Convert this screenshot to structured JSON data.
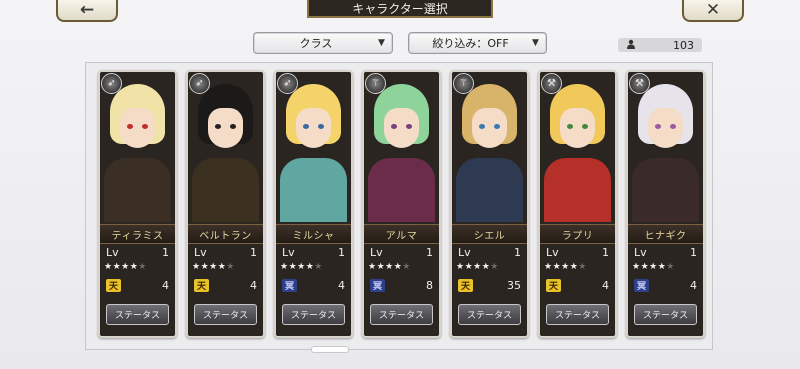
{
  "header": {
    "title": "キャラクター選択",
    "back_icon": "←",
    "close_icon": "✕"
  },
  "filters": {
    "class_label": "クラス",
    "filter_label": "絞り込み：OFF",
    "arrow": "▼"
  },
  "counter": {
    "value": "103",
    "icon": "person-icon"
  },
  "cards": [
    {
      "name": "ティラミス",
      "lv_label": "Lv",
      "lv": "1",
      "stars": "★★★★",
      "dim_star": "★",
      "badge": "天",
      "badge_color": "gold",
      "stat": "4",
      "button": "ステータス",
      "class_icon": "bow-icon",
      "hair": "#f1e3a8",
      "body": "#3b2f25",
      "eyes": "#c03030"
    },
    {
      "name": "ベルトラン",
      "lv_label": "Lv",
      "lv": "1",
      "stars": "★★★★",
      "dim_star": "★",
      "badge": "天",
      "badge_color": "gold",
      "stat": "4",
      "button": "ステータス",
      "class_icon": "bow-icon",
      "hair": "#1c1a18",
      "body": "#3c3020",
      "eyes": "#222222"
    },
    {
      "name": "ミルシャ",
      "lv_label": "Lv",
      "lv": "1",
      "stars": "★★★★",
      "dim_star": "★",
      "badge": "冥",
      "badge_color": "blue",
      "stat": "4",
      "button": "ステータス",
      "class_icon": "bow-icon",
      "hair": "#f4d36a",
      "body": "#5fa7a0",
      "eyes": "#3a6aa0"
    },
    {
      "name": "アルマ",
      "lv_label": "Lv",
      "lv": "1",
      "stars": "★★★★",
      "dim_star": "★",
      "badge": "冥",
      "badge_color": "blue",
      "stat": "8",
      "button": "ステータス",
      "class_icon": "staff-icon",
      "hair": "#8ed49a",
      "body": "#6b2c4a",
      "eyes": "#7a3f7f"
    },
    {
      "name": "シエル",
      "lv_label": "Lv",
      "lv": "1",
      "stars": "★★★★",
      "dim_star": "★",
      "badge": "天",
      "badge_color": "gold",
      "stat": "35",
      "button": "ステータス",
      "class_icon": "staff-icon",
      "hair": "#d8b46a",
      "body": "#2e3a52",
      "eyes": "#3a7ab0"
    },
    {
      "name": "ラプリ",
      "lv_label": "Lv",
      "lv": "1",
      "stars": "★★★★",
      "dim_star": "★",
      "badge": "天",
      "badge_color": "gold",
      "stat": "4",
      "button": "ステータス",
      "class_icon": "hammer-icon",
      "hair": "#f1c85a",
      "body": "#b43028",
      "eyes": "#3f8a3a"
    },
    {
      "name": "ヒナギク",
      "lv_label": "Lv",
      "lv": "1",
      "stars": "★★★★",
      "dim_star": "★",
      "badge": "冥",
      "badge_color": "blue",
      "stat": "4",
      "button": "ステータス",
      "class_icon": "hammer-icon",
      "hair": "#e6e3ea",
      "body": "#3a2a2a",
      "eyes": "#9a5aa0"
    }
  ]
}
